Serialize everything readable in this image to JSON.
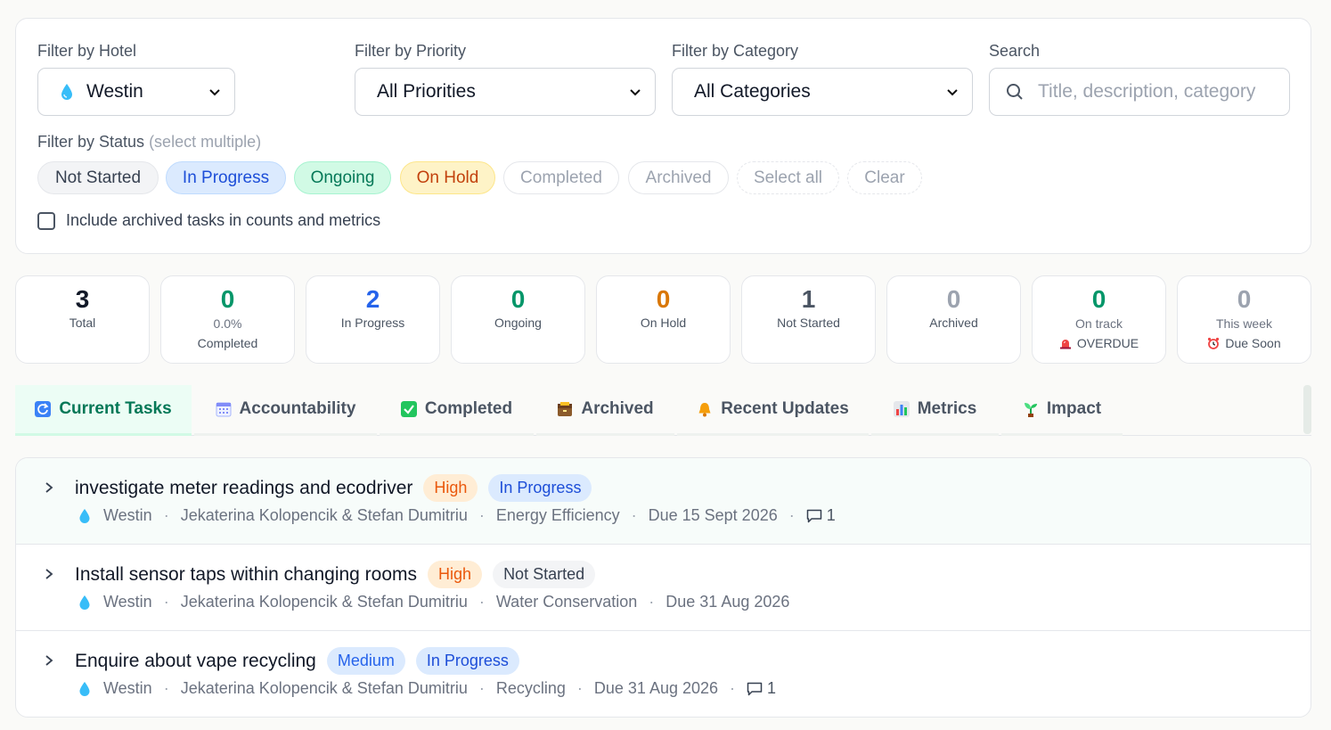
{
  "filters": {
    "hotel": {
      "label": "Filter by Hotel",
      "value": "Westin",
      "icon": "droplet-icon"
    },
    "priority": {
      "label": "Filter by Priority",
      "value": "All Priorities"
    },
    "category": {
      "label": "Filter by Category",
      "value": "All Categories"
    },
    "search": {
      "label": "Search",
      "placeholder": "Title, description, category"
    },
    "status": {
      "label": "Filter by Status",
      "hint": "(select multiple)",
      "chips": [
        "Not Started",
        "In Progress",
        "Ongoing",
        "On Hold",
        "Completed",
        "Archived"
      ],
      "select_all": "Select all",
      "clear": "Clear"
    },
    "include_archived": "Include archived tasks in counts and metrics"
  },
  "stats": [
    {
      "value": "3",
      "label": "Total",
      "color": "#111827"
    },
    {
      "value": "0",
      "sub": "0.0%",
      "label": "Completed",
      "color": "#059669"
    },
    {
      "value": "2",
      "label": "In Progress",
      "color": "#2563eb"
    },
    {
      "value": "0",
      "label": "Ongoing",
      "color": "#059669"
    },
    {
      "value": "0",
      "label": "On Hold",
      "color": "#d97706"
    },
    {
      "value": "1",
      "label": "Not Started",
      "color": "#4b5563"
    },
    {
      "value": "0",
      "label": "Archived",
      "color": "#9ca3af"
    },
    {
      "value": "0",
      "sub": "On track",
      "label": "OVERDUE",
      "icon": "siren-icon",
      "color": "#059669"
    },
    {
      "value": "0",
      "sub": "This week",
      "label": "Due Soon",
      "icon": "alarm-clock-icon",
      "color": "#9ca3af"
    }
  ],
  "tabs": [
    {
      "label": "Current Tasks",
      "icon": "refresh-icon",
      "active": true
    },
    {
      "label": "Accountability",
      "icon": "calendar-icon"
    },
    {
      "label": "Completed",
      "icon": "check-box-icon"
    },
    {
      "label": "Archived",
      "icon": "archive-box-icon"
    },
    {
      "label": "Recent Updates",
      "icon": "bell-icon"
    },
    {
      "label": "Metrics",
      "icon": "bar-chart-icon"
    },
    {
      "label": "Impact",
      "icon": "seedling-icon"
    }
  ],
  "tasks": [
    {
      "title": "investigate meter readings and ecodriver",
      "priority": "High",
      "status": "In Progress",
      "hotel": "Westin",
      "assignees": "Jekaterina Kolopencik & Stefan Dumitriu",
      "category": "Energy Efficiency",
      "due": "Due 15 Sept 2026",
      "comments": "1"
    },
    {
      "title": "Install sensor taps within changing rooms",
      "priority": "High",
      "status": "Not Started",
      "hotel": "Westin",
      "assignees": "Jekaterina Kolopencik & Stefan Dumitriu",
      "category": "Water Conservation",
      "due": "Due 31 Aug 2026"
    },
    {
      "title": "Enquire about vape recycling",
      "priority": "Medium",
      "status": "In Progress",
      "hotel": "Westin",
      "assignees": "Jekaterina Kolopencik & Stefan Dumitriu",
      "category": "Recycling",
      "due": "Due 31 Aug 2026",
      "comments": "1"
    }
  ],
  "meta_separator": "·"
}
